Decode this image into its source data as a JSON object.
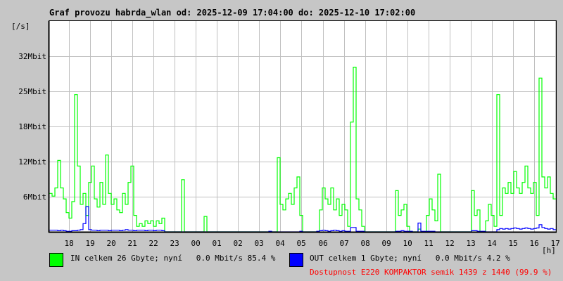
{
  "chart_data": {
    "type": "line",
    "title": "Graf provozu habrda_wlan od: 2025-12-09 17:04:00 do: 2025-12-10 17:02:00",
    "ylabel": "[/s]",
    "xlabel": "[h]",
    "y_unit": "Mbit",
    "ylim": [
      0,
      38.4
    ],
    "ytick_values": [
      6.4,
      12.8,
      19.2,
      25.6,
      32
    ],
    "ytick_labels": [
      "6Mbit",
      "12Mbit",
      "18Mbit",
      "25Mbit",
      "32Mbit"
    ],
    "x_start_hour": 17.067,
    "x_end_hour": 41.033,
    "sample_interval_minutes": 8,
    "xtick_hours": [
      18,
      19,
      20,
      21,
      22,
      23,
      24,
      25,
      26,
      27,
      28,
      29,
      30,
      31,
      32,
      33,
      34,
      35,
      36,
      37,
      38,
      39,
      40,
      41
    ],
    "xtick_labels": [
      "18",
      "19",
      "20",
      "21",
      "22",
      "23",
      "00",
      "01",
      "02",
      "03",
      "04",
      "05",
      "06",
      "07",
      "08",
      "09",
      "10",
      "11",
      "12",
      "13",
      "14",
      "15",
      "16",
      "17"
    ],
    "grid": true,
    "series": [
      {
        "name": "IN",
        "color": "#00ff00",
        "values": [
          7,
          6.5,
          8,
          13,
          8,
          6,
          3.5,
          2.5,
          5.5,
          25,
          12,
          5,
          7,
          3,
          9,
          12,
          6,
          4.5,
          9,
          5,
          14,
          7,
          5,
          6,
          4,
          3.5,
          7,
          5,
          9,
          12,
          3,
          1,
          1.5,
          1,
          2,
          1.5,
          2,
          1,
          2,
          1.5,
          2.5,
          0,
          0,
          0,
          0,
          0,
          0,
          9.5,
          0,
          0,
          0,
          0,
          0,
          0,
          0,
          2.8,
          0,
          0,
          0,
          0,
          0,
          0,
          0,
          0,
          0,
          0,
          0,
          0,
          0,
          0,
          0,
          0,
          0,
          0,
          0,
          0,
          0,
          0,
          0,
          0,
          0,
          13.5,
          5,
          4,
          6,
          7,
          5,
          8,
          10,
          3,
          0,
          0,
          0,
          0,
          0,
          0,
          4,
          8,
          6,
          5,
          8,
          4,
          6,
          3,
          5,
          4,
          1,
          20,
          30,
          6,
          4,
          1,
          0,
          0,
          0,
          0,
          0,
          0,
          0,
          0,
          0,
          0,
          0,
          7.5,
          3,
          4,
          5,
          1,
          0,
          0,
          0,
          0.5,
          0,
          0,
          3,
          6,
          4,
          2,
          10.5,
          0,
          0,
          0,
          0,
          0,
          0,
          0,
          0,
          0,
          0,
          0,
          7.5,
          3,
          4,
          0,
          0,
          2,
          5,
          3,
          1,
          25,
          3,
          8,
          7,
          9,
          7,
          11,
          8,
          7,
          9,
          12,
          8,
          7,
          9,
          3,
          28,
          10,
          8,
          10,
          7,
          6
        ]
      },
      {
        "name": "OUT",
        "color": "#0000ff",
        "values": [
          0.3,
          0.3,
          0.3,
          0.2,
          0.3,
          0.2,
          0.1,
          0.1,
          0.2,
          0.2,
          0.3,
          0.4,
          1.5,
          4.6,
          0.4,
          0.3,
          0.3,
          0.2,
          0.3,
          0.3,
          0.3,
          0.2,
          0.3,
          0.3,
          0.3,
          0.2,
          0.3,
          0.4,
          0.3,
          0.3,
          0.2,
          0.3,
          0.3,
          0.3,
          0.2,
          0.3,
          0.3,
          0.2,
          0.3,
          0.3,
          0.2,
          0,
          0,
          0,
          0,
          0,
          0,
          0,
          0,
          0,
          0,
          0,
          0,
          0,
          0,
          0,
          0,
          0,
          0,
          0,
          0,
          0,
          0,
          0,
          0,
          0,
          0,
          0,
          0,
          0,
          0,
          0,
          0,
          0,
          0,
          0,
          0,
          0,
          0.1,
          0,
          0,
          0,
          0,
          0,
          0,
          0,
          0,
          0,
          0,
          0.1,
          0,
          0,
          0,
          0,
          0,
          0.1,
          0.2,
          0.3,
          0.2,
          0.1,
          0.2,
          0.3,
          0.2,
          0.1,
          0.2,
          0.1,
          0.1,
          0.8,
          0.8,
          0.1,
          0.1,
          0.1,
          0,
          0,
          0,
          0,
          0,
          0,
          0,
          0,
          0,
          0,
          0,
          0.1,
          0.1,
          0.2,
          0.1,
          0.1,
          0.1,
          0,
          0,
          1.6,
          0.1,
          0.1,
          0.1,
          0.1,
          0.1,
          0,
          0,
          0,
          0,
          0,
          0,
          0,
          0,
          0,
          0,
          0,
          0,
          0,
          0.2,
          0.2,
          0.1,
          0.1,
          0.1,
          0,
          0,
          0,
          0,
          0.4,
          0.6,
          0.5,
          0.6,
          0.5,
          0.6,
          0.7,
          0.6,
          0.5,
          0.6,
          0.7,
          0.6,
          0.5,
          0.6,
          0.7,
          1.3,
          0.8,
          0.6,
          0.5,
          0.6,
          0.4
        ]
      }
    ]
  },
  "legend": {
    "in_text": "IN celkem 26 Gbyte; nyní   0.0 Mbit/s 85.4 %",
    "out_text": "OUT celkem 1 Gbyte; nyní   0.0 Mbit/s 4.2 %",
    "availability_text": "Dostupnost E220 KOMPAKTOR semik 1439 z 1440 (99.9 %)",
    "availability_color": "#ff0000"
  }
}
